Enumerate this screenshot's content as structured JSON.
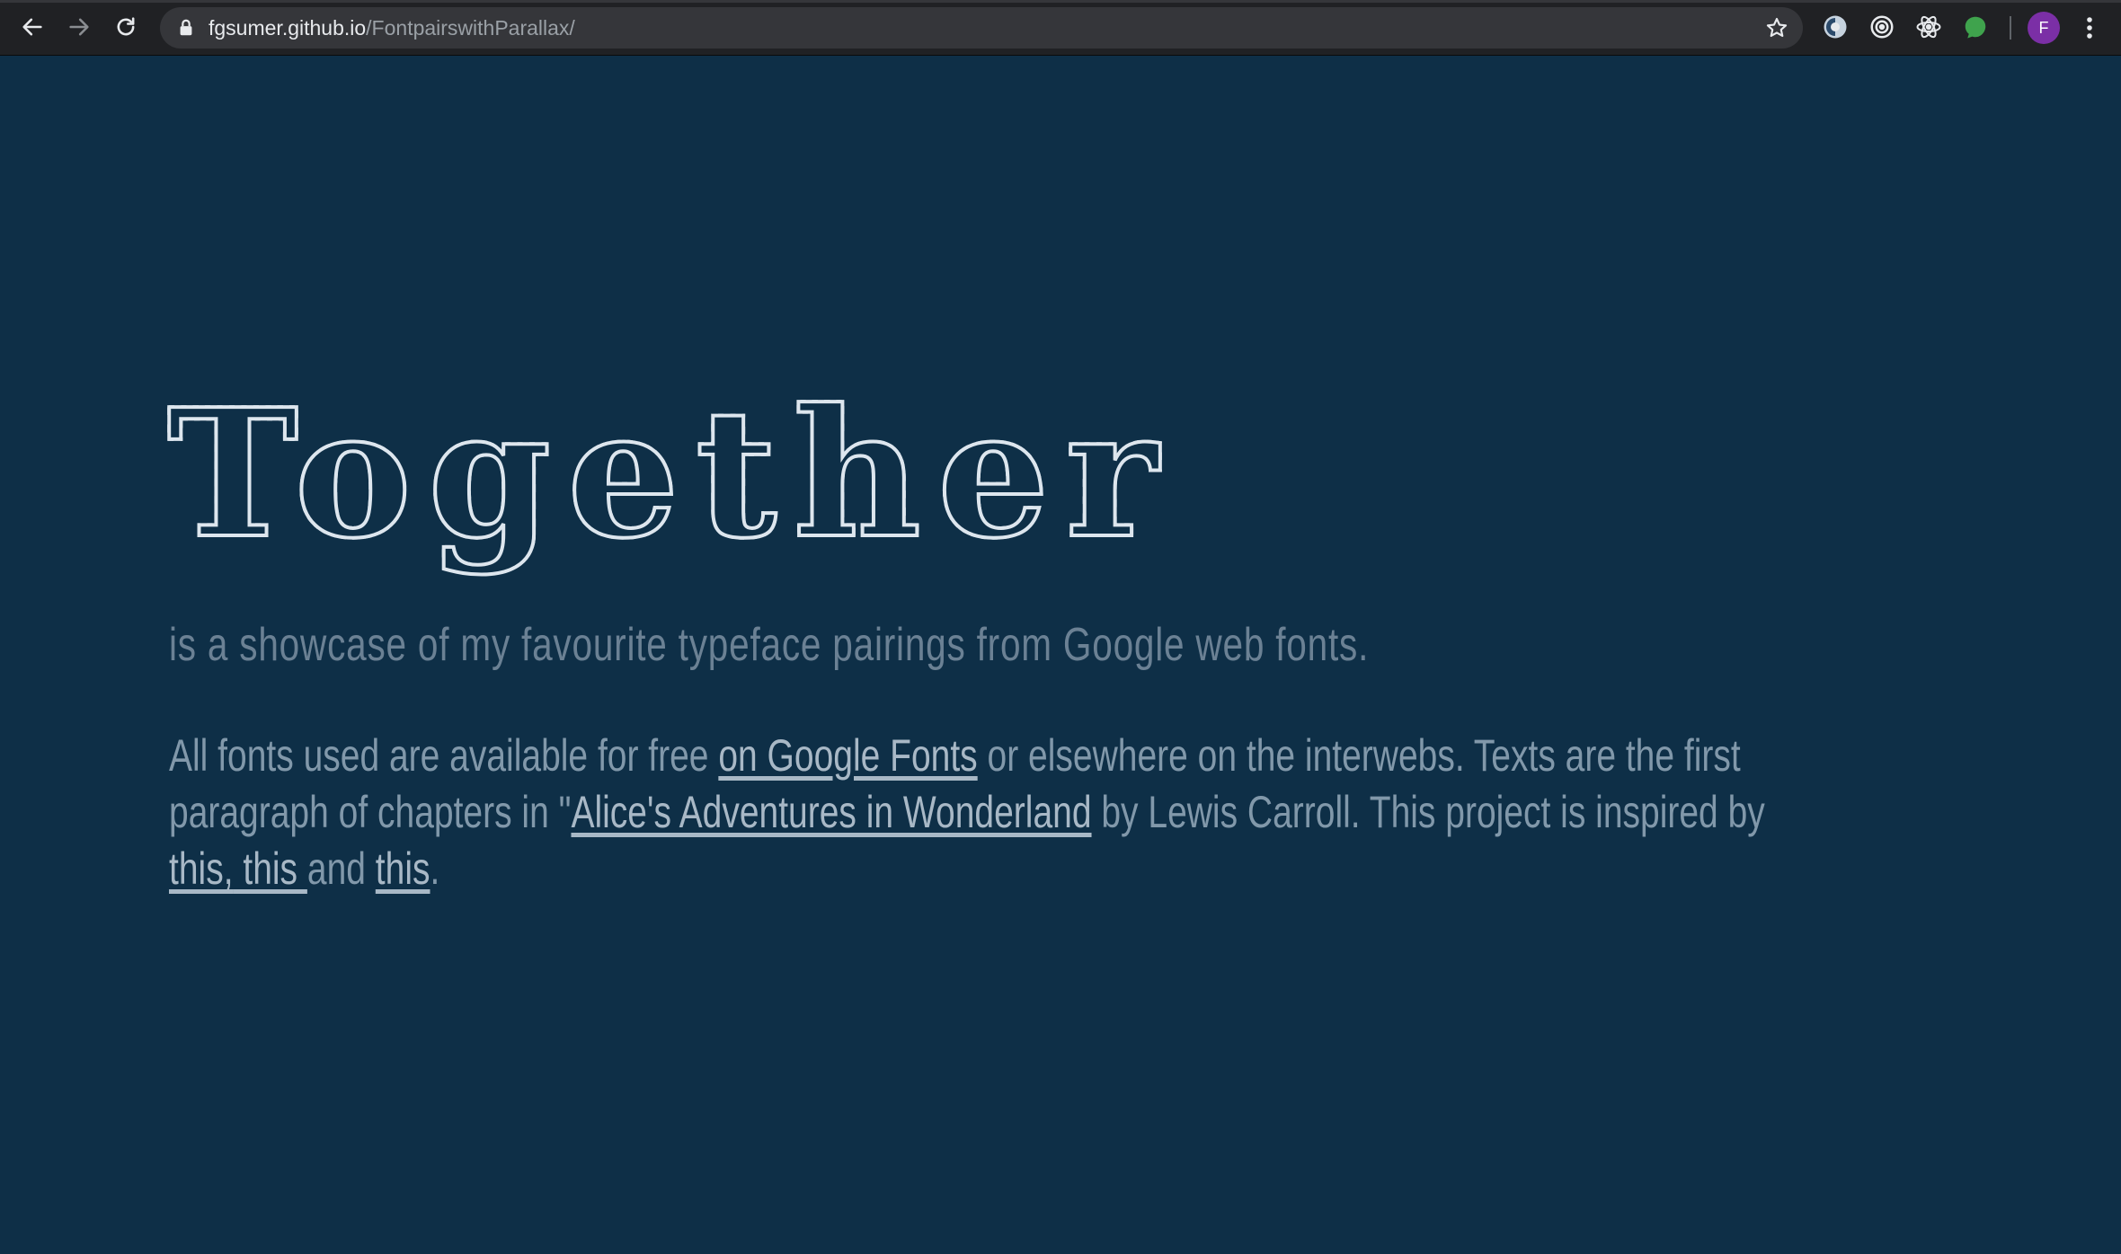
{
  "browser": {
    "url_host": "fgsumer.github.io",
    "url_path": "/FontpairswithParallax/",
    "profile_initial": "F",
    "icons": {
      "back": "arrow-left-icon",
      "forward": "arrow-right-icon",
      "reload": "reload-icon",
      "lock": "lock-icon",
      "bookmark": "star-icon",
      "menu": "kebab-menu-icon"
    },
    "extensions": [
      "half-circle-extension-icon",
      "target-extension-icon",
      "react-atom-extension-icon",
      "green-leaf-extension-icon"
    ]
  },
  "hero": {
    "title": "Together",
    "tagline": "is a showcase of my favourite typeface pairings from Google web fonts.",
    "desc_1": "All fonts used are available for free ",
    "link_google_fonts": "on Google Fonts",
    "desc_2": " or elsewhere on the interwebs. Texts are the first paragraph of chapters in \"",
    "link_alice": "Alice's Adventures in Wonderland",
    "desc_3": " by Lewis Carroll. This project is inspired by ",
    "link_this_1": "this,",
    "link_this_2": " this ",
    "desc_4": "and ",
    "link_this_3": "this",
    "desc_5": "."
  },
  "colors": {
    "page_background": "#0e2f47",
    "title": "#dde6ee",
    "tagline": "#6b8194",
    "body": "#8198aa",
    "chrome": "#202124",
    "avatar": "#7b2fa6"
  }
}
